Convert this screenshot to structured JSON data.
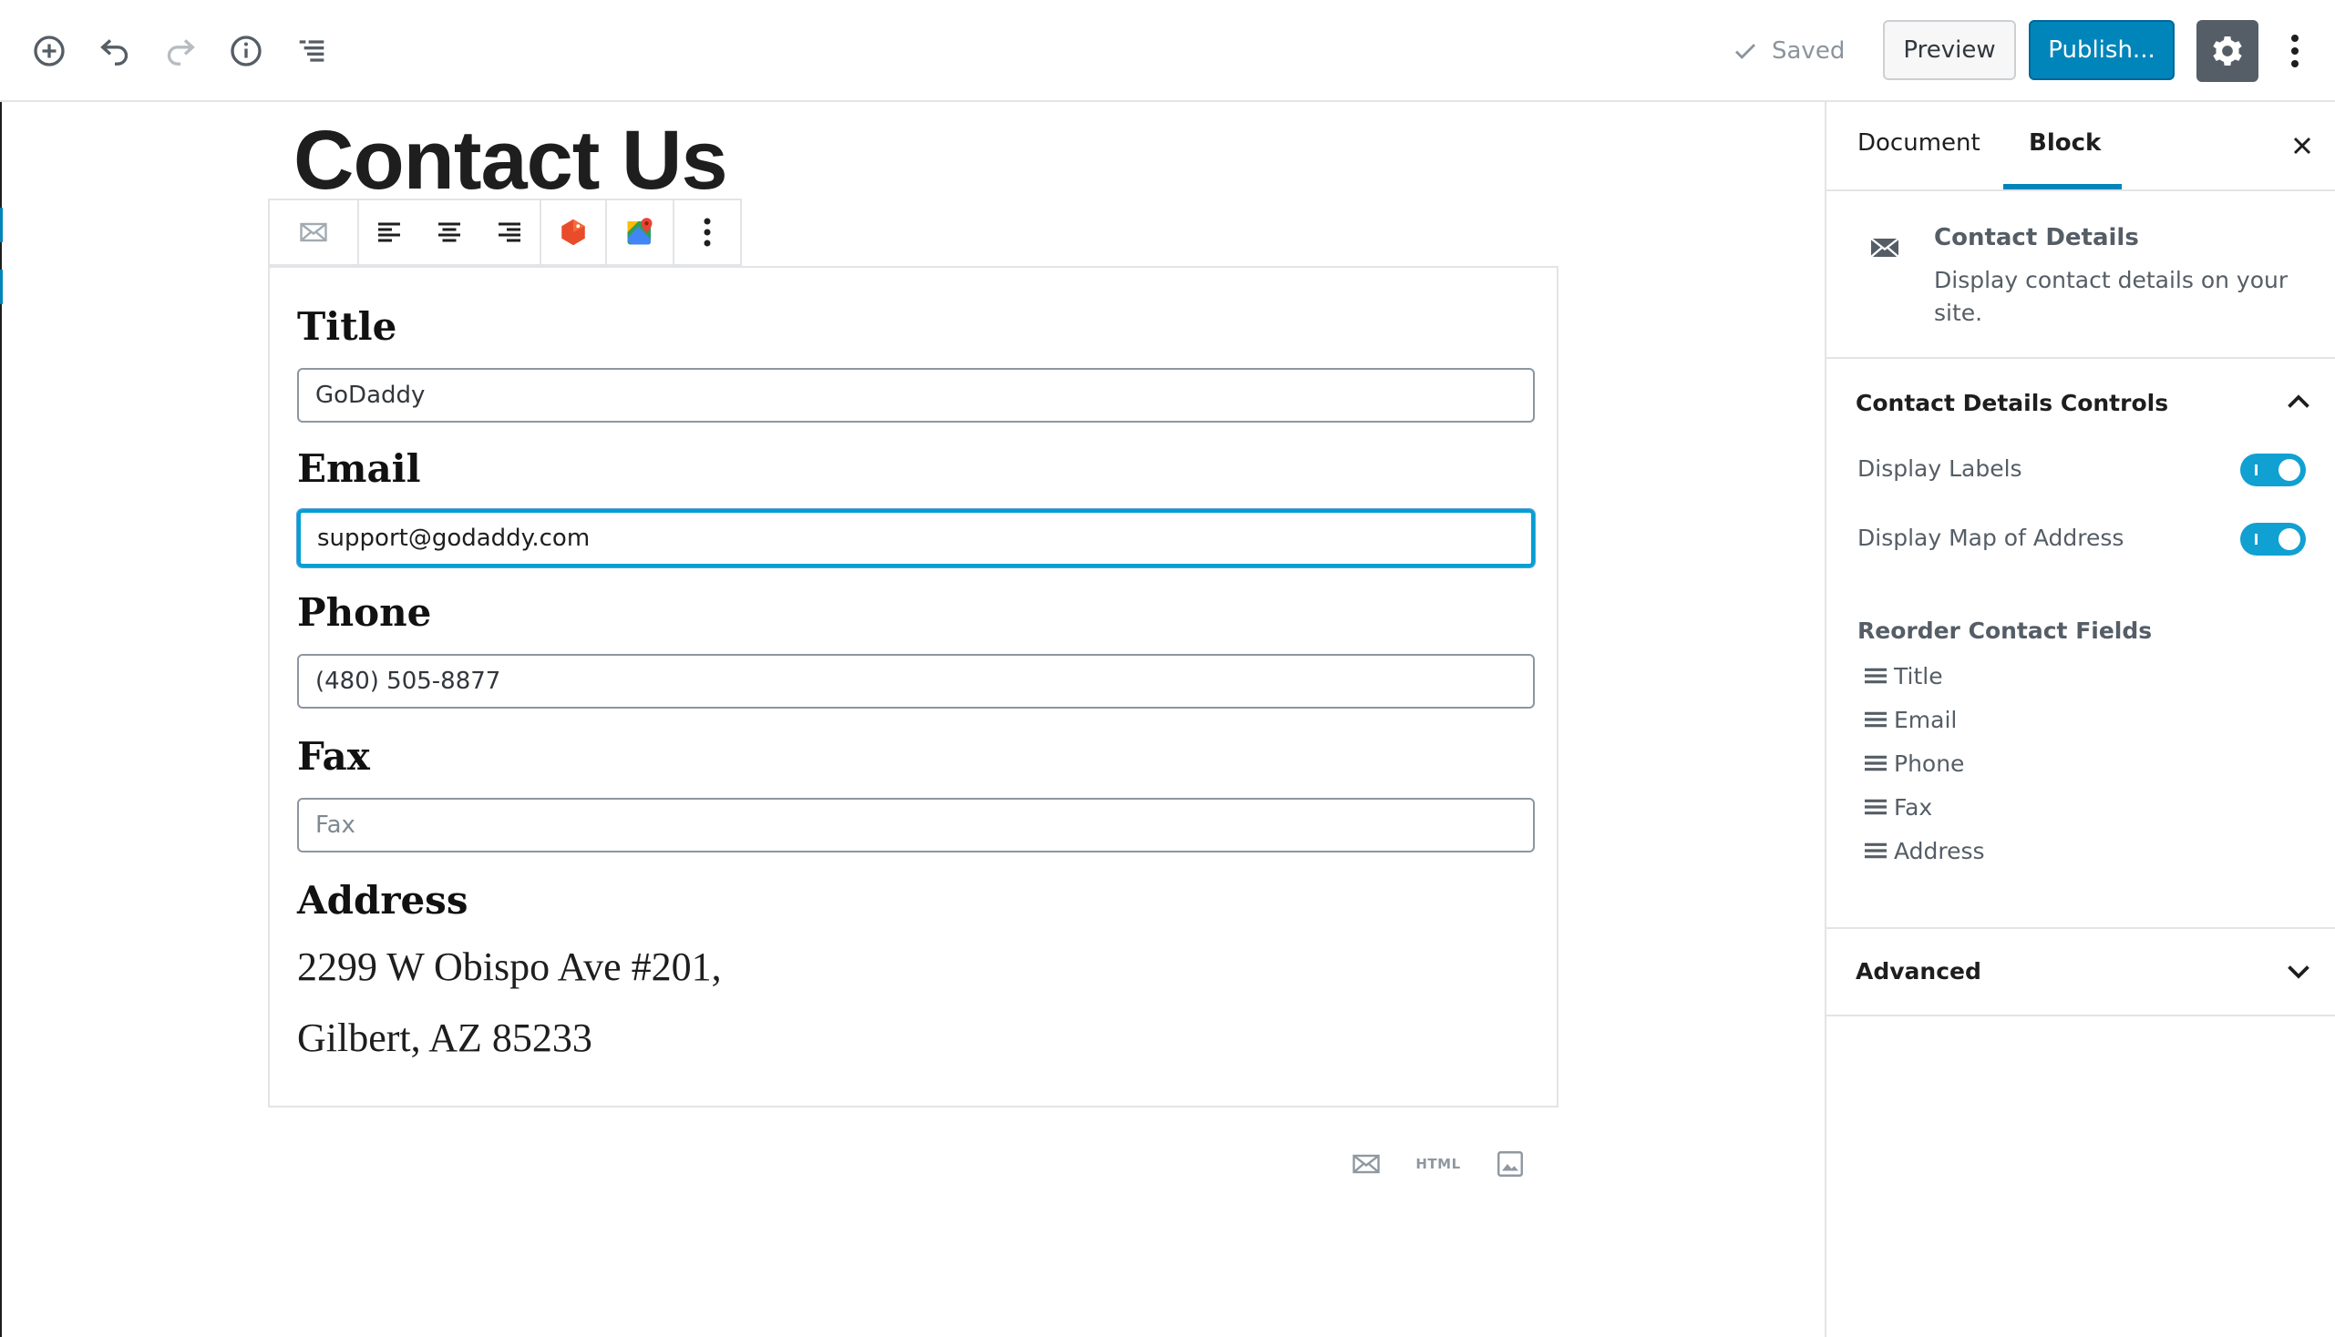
{
  "topbar": {
    "icons": {
      "add": "plus-circle-icon",
      "undo": "undo-icon",
      "redo": "redo-icon",
      "info": "info-icon",
      "outline": "list-outline-icon"
    },
    "saved_label": "Saved",
    "preview_label": "Preview",
    "publish_label": "Publish...",
    "settings_icon": "gear-icon",
    "more_icon": "more-vertical-icon"
  },
  "editor": {
    "page_title": "Contact Us",
    "block_toolbar": {
      "icons": [
        "envelope-icon",
        "align-left-icon",
        "align-center-icon",
        "align-right-icon",
        "tag-icon",
        "map-icon",
        "more-vertical-icon"
      ]
    },
    "fields": {
      "title": {
        "label": "Title",
        "value": "GoDaddy"
      },
      "email": {
        "label": "Email",
        "value": "support@godaddy.com"
      },
      "phone": {
        "label": "Phone",
        "value": "(480) 505-8877"
      },
      "fax": {
        "label": "Fax",
        "placeholder": "Fax"
      },
      "address": {
        "label": "Address",
        "line1": "2299 W Obispo Ave #201,",
        "line2": "Gilbert, AZ 85233"
      }
    },
    "bottom_tools": {
      "html_label": "HTML"
    }
  },
  "sidebar": {
    "tabs": [
      "Document",
      "Block"
    ],
    "active_tab": "Block",
    "block_card": {
      "title": "Contact Details",
      "description": "Display contact details on your site."
    },
    "controls_panel": {
      "title": "Contact Details Controls",
      "toggles": [
        {
          "label": "Display Labels",
          "on": true
        },
        {
          "label": "Display Map of Address",
          "on": true
        }
      ],
      "reorder_title": "Reorder Contact Fields",
      "reorder_items": [
        "Title",
        "Email",
        "Phone",
        "Fax",
        "Address"
      ]
    },
    "advanced_panel": {
      "title": "Advanced"
    }
  },
  "colors": {
    "accent": "#0085ba",
    "toggle_on": "#11a0d2",
    "focus_border": "#00a0d2"
  }
}
